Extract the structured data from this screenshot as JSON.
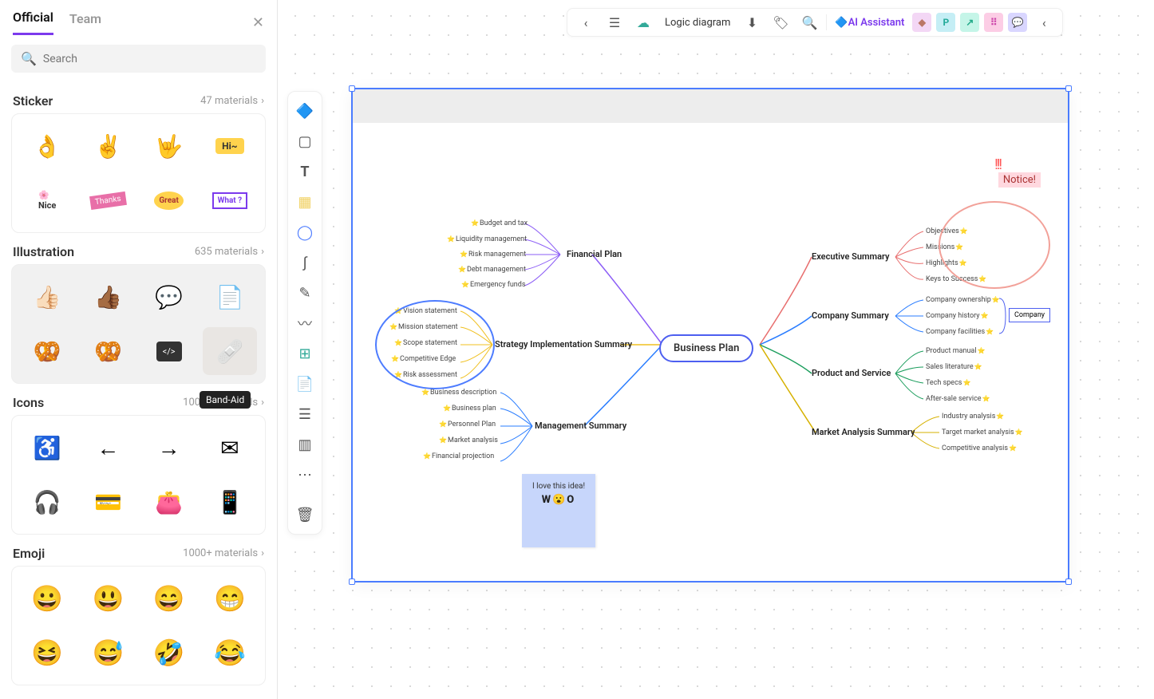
{
  "tabs": {
    "official": "Official",
    "team": "Team"
  },
  "search": {
    "placeholder": "Search"
  },
  "sections": {
    "sticker": {
      "title": "Sticker",
      "count": "47 materials"
    },
    "illustration": {
      "title": "Illustration",
      "count": "635 materials"
    },
    "icons": {
      "title": "Icons",
      "count": "1000+ materials"
    },
    "emoji": {
      "title": "Emoji",
      "count": "1000+ materials"
    }
  },
  "stickers": [
    "👌",
    "✌️",
    "🤟",
    "Hi~",
    "🌸Nice",
    "Thanks",
    "Great",
    "What ?"
  ],
  "illustrations": [
    "👍🏻",
    "👍🏾",
    "💬",
    "📄🔥",
    "🥨",
    "🥨",
    "</>",
    "Band-Aid"
  ],
  "tooltip": "Band-Aid",
  "emojis": [
    "😀",
    "😃",
    "😄",
    "😁",
    "😆",
    "😅",
    "🤣",
    "😂"
  ],
  "topbar": {
    "title": "Logic diagram",
    "ai": "AI Assistant"
  },
  "mindmap": {
    "center": "Business Plan",
    "notice": "Notice!",
    "company_tag": "Company",
    "sticky": {
      "text": "I love this idea!",
      "emoji": "W😮O"
    },
    "left": {
      "financial": {
        "label": "Financial Plan",
        "items": [
          "Budget and tax",
          "Liquidity management",
          "Risk management",
          "Debt management",
          "Emergency funds"
        ]
      },
      "strategy": {
        "label": "Strategy Implementation Summary",
        "items": [
          "Vision statement",
          "Mission statement",
          "Scope statement",
          "Competitive Edge",
          "Risk assessment"
        ]
      },
      "management": {
        "label": "Management Summary",
        "items": [
          "Business description",
          "Business plan",
          "Personnel Plan",
          "Market analysis",
          "Financial  projection"
        ]
      }
    },
    "right": {
      "executive": {
        "label": "Executive Summary",
        "items": [
          "Objectives",
          "Missions",
          "Highlights",
          "Keys to Success"
        ]
      },
      "company": {
        "label": "Company Summary",
        "items": [
          "Company ownership",
          "Company history",
          "Company facilities"
        ]
      },
      "product": {
        "label": "Product and Service",
        "items": [
          "Product manual",
          "Sales literature",
          "Tech specs",
          "After-sale service"
        ]
      },
      "market": {
        "label": "Market Analysis Summary",
        "items": [
          "Industry analysis",
          "Target market analysis",
          "Competitive analysis"
        ]
      }
    }
  }
}
